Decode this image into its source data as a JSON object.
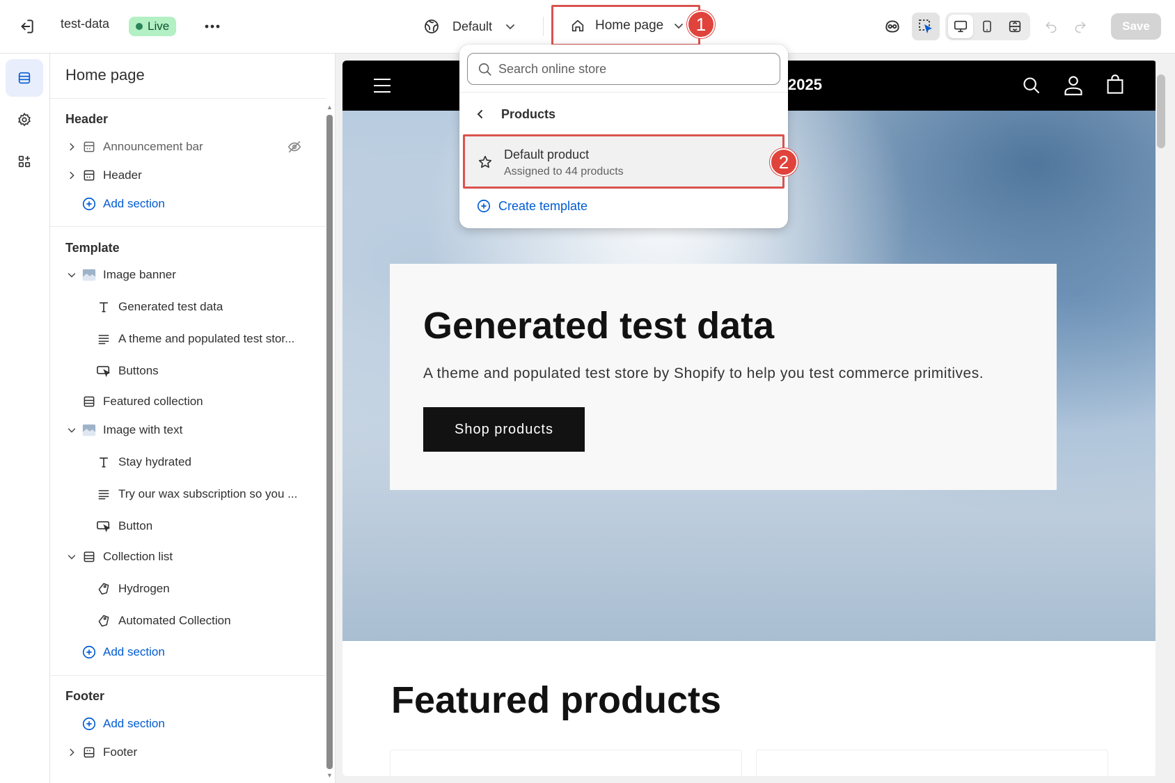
{
  "topbar": {
    "store_name": "test-data",
    "live_badge": "Live",
    "more_icon": "ellipsis-icon",
    "theme_label": "Default",
    "page_label": "Home page",
    "save_label": "Save"
  },
  "annotations": {
    "callout_1": "1",
    "callout_2": "2",
    "highlight_color": "#d9534f"
  },
  "rail": {
    "items": [
      {
        "name": "sections",
        "icon": "sections-icon",
        "active": true
      },
      {
        "name": "theme-settings",
        "icon": "gear-icon",
        "active": false
      },
      {
        "name": "apps",
        "icon": "apps-icon",
        "active": false
      }
    ]
  },
  "sidebar": {
    "title": "Home page",
    "header_group": {
      "title": "Header",
      "items": [
        {
          "label": "Announcement bar",
          "icon": "section-icon",
          "hidden": true
        },
        {
          "label": "Header",
          "icon": "section-icon",
          "hidden": false
        }
      ],
      "add_section": "Add section"
    },
    "template_group": {
      "title": "Template",
      "items": [
        {
          "label": "Image banner",
          "icon": "image-icon",
          "expanded": true
        },
        {
          "label": "Generated test data",
          "icon": "text-icon"
        },
        {
          "label": "A theme and populated test stor...",
          "icon": "paragraph-icon"
        },
        {
          "label": "Buttons",
          "icon": "button-icon"
        },
        {
          "label": "Featured collection",
          "icon": "section-icon"
        },
        {
          "label": "Image with text",
          "icon": "image-icon",
          "expanded": true
        },
        {
          "label": "Stay hydrated",
          "icon": "text-icon"
        },
        {
          "label": "Try our wax subscription so you ...",
          "icon": "paragraph-icon"
        },
        {
          "label": "Button",
          "icon": "button-icon"
        },
        {
          "label": "Collection list",
          "icon": "section-icon",
          "expanded": true
        },
        {
          "label": "Hydrogen",
          "icon": "collection-icon"
        },
        {
          "label": "Automated Collection",
          "icon": "collection-icon"
        }
      ],
      "add_section": "Add section"
    },
    "footer_group": {
      "title": "Footer",
      "add_section": "Add section",
      "items": [
        {
          "label": "Footer",
          "icon": "section-icon"
        }
      ]
    }
  },
  "dropdown": {
    "search_placeholder": "Search online store",
    "back_label": "Products",
    "item_title": "Default product",
    "item_subtitle": "Assigned to 44 products",
    "create_label": "Create template"
  },
  "preview": {
    "store_title_partial": "2025",
    "hero_heading": "Generated test data",
    "hero_subtitle": "A theme and populated test store by Shopify to help you test commerce primitives.",
    "hero_button": "Shop products",
    "featured_heading": "Featured products"
  },
  "colors": {
    "accent_blue": "#005bd3",
    "live_green": "#b3f0c4",
    "annotation_red": "#e0433c"
  }
}
